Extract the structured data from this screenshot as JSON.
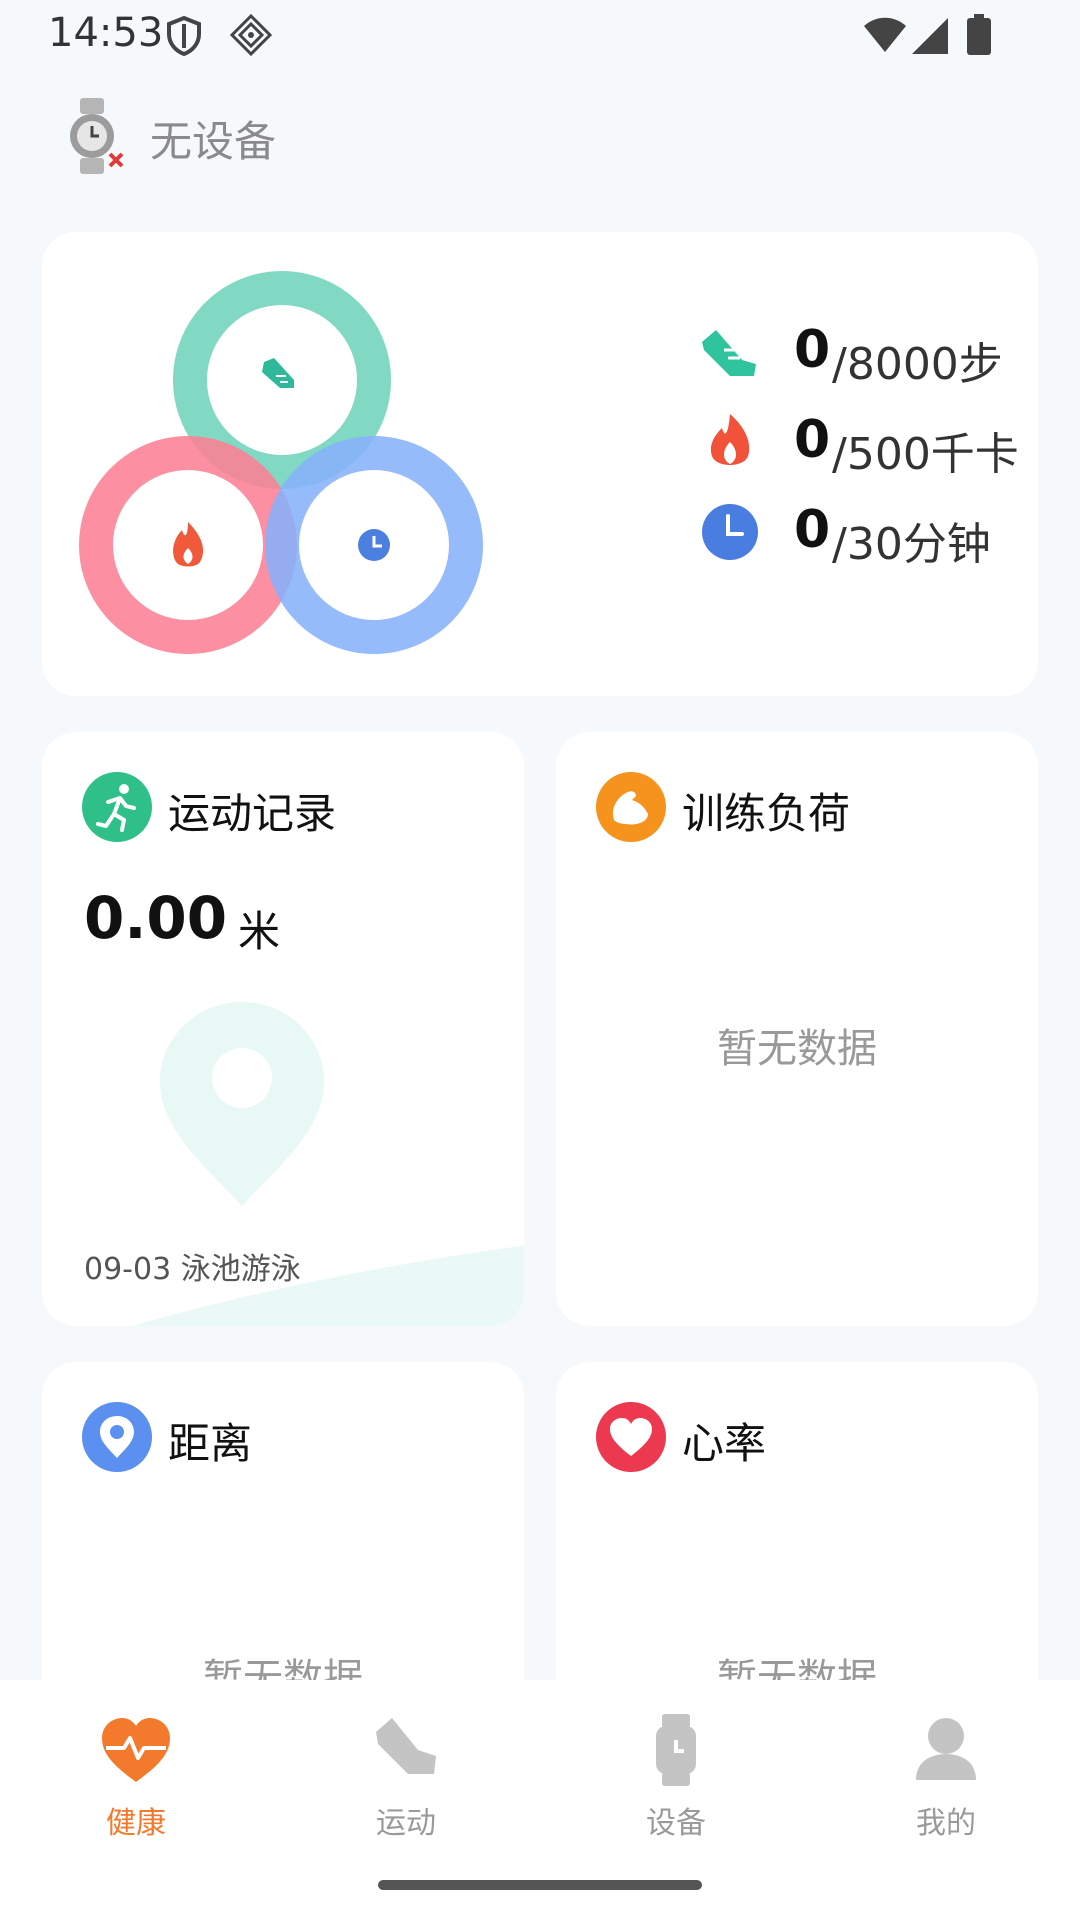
{
  "status": {
    "time": "14:53"
  },
  "device": {
    "label": "无设备"
  },
  "activity": {
    "steps": {
      "value": "0",
      "goal": "/8000步"
    },
    "calories": {
      "value": "0",
      "goal": "/500千卡"
    },
    "minutes": {
      "value": "0",
      "goal": "/30分钟"
    }
  },
  "exercise_record": {
    "title": "运动记录",
    "distance_value": "0.00",
    "distance_unit": "米",
    "last": "09-03 泳池游泳"
  },
  "training_load": {
    "title": "训练负荷",
    "empty": "暂无数据"
  },
  "distance": {
    "title": "距离",
    "empty": "暂无数据"
  },
  "heart_rate": {
    "title": "心率",
    "empty": "暂无数据"
  },
  "tabs": [
    {
      "label": "健康",
      "icon": "heart-pulse-icon",
      "active": true
    },
    {
      "label": "运动",
      "icon": "shoe-icon",
      "active": false
    },
    {
      "label": "设备",
      "icon": "watch-icon",
      "active": false
    },
    {
      "label": "我的",
      "icon": "user-icon",
      "active": false
    }
  ],
  "colors": {
    "accent": "#f37a2d",
    "steps_ring": "#6fd4bb",
    "calories_ring": "#fc7f95",
    "minutes_ring": "#86b2fb"
  }
}
